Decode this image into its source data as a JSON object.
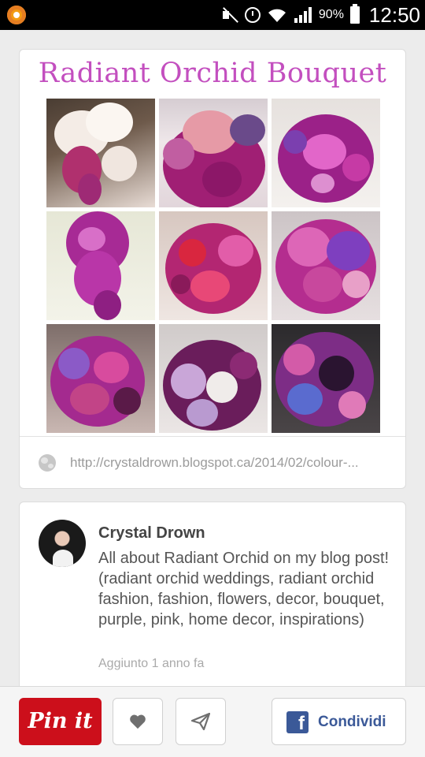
{
  "status_bar": {
    "battery_percent": "90%",
    "time": "12:50",
    "icons": [
      "app-notification-icon",
      "mute-icon",
      "alarm-icon",
      "wifi-icon",
      "signal-icon",
      "battery-icon"
    ]
  },
  "pin": {
    "image_title": "Radiant Orchid Bouquet",
    "source_url": "http://crystaldrown.blogspot.ca/2014/02/colour-...",
    "colors": {
      "title_accent": "#c34fbf"
    }
  },
  "description_card": {
    "author": "Crystal Drown",
    "text": "All about Radiant Orchid on my blog post! (radiant orchid weddings, radiant orchid fashion, fashion, flowers, decor, bouquet, purple, pink, home decor, inspirations)",
    "timestamp": "Aggiunto 1 anno fa"
  },
  "actions": {
    "pin_label": "Pin it",
    "share_label": "Condividi",
    "colors": {
      "pin_red": "#cc0f1b",
      "facebook_blue": "#3b5998"
    }
  }
}
